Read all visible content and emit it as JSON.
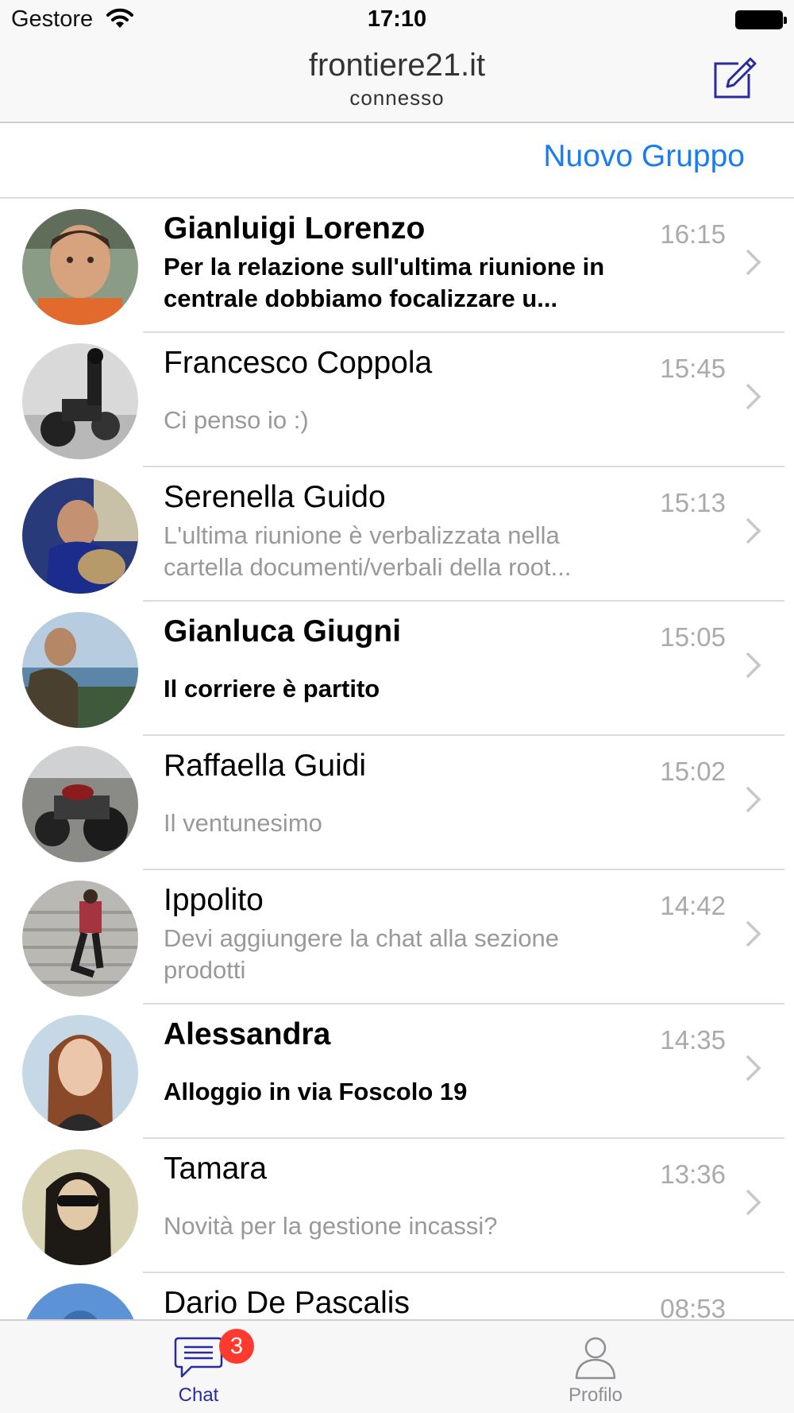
{
  "status_bar": {
    "carrier": "Gestore",
    "time": "17:10"
  },
  "nav": {
    "title": "frontiere21.it",
    "subtitle": "connesso"
  },
  "actions": {
    "new_group_label": "Nuovo Gruppo"
  },
  "chats": [
    {
      "name": "Gianluigi Lorenzo",
      "time": "16:15",
      "preview": "Per la relazione sull'ultima riunione in centrale dobbiamo focalizzare u...",
      "unread": true
    },
    {
      "name": "Francesco Coppola",
      "time": "15:45",
      "preview": "Ci penso io :)",
      "unread": false
    },
    {
      "name": "Serenella Guido",
      "time": "15:13",
      "preview": "L'ultima riunione è verbalizzata nella cartella documenti/verbali della root...",
      "unread": false
    },
    {
      "name": "Gianluca Giugni",
      "time": "15:05",
      "preview": "Il corriere è partito",
      "unread": true
    },
    {
      "name": "Raffaella Guidi",
      "time": "15:02",
      "preview": "Il ventunesimo",
      "unread": false
    },
    {
      "name": "Ippolito",
      "time": "14:42",
      "preview": "Devi aggiungere la chat alla sezione prodotti",
      "unread": false
    },
    {
      "name": "Alessandra",
      "time": "14:35",
      "preview": "Alloggio in via Foscolo 19",
      "unread": true
    },
    {
      "name": "Tamara",
      "time": "13:36",
      "preview": "Novità per la gestione incassi?",
      "unread": false
    },
    {
      "name": "Dario De Pascalis",
      "time": "08:53",
      "preview": "",
      "unread": false
    }
  ],
  "tabs": {
    "chat_label": "Chat",
    "chat_badge": "3",
    "profile_label": "Profilo"
  },
  "colors": {
    "accent": "#1a7cf3",
    "tab_active": "#2a2aa0",
    "badge": "#ff3b30"
  }
}
